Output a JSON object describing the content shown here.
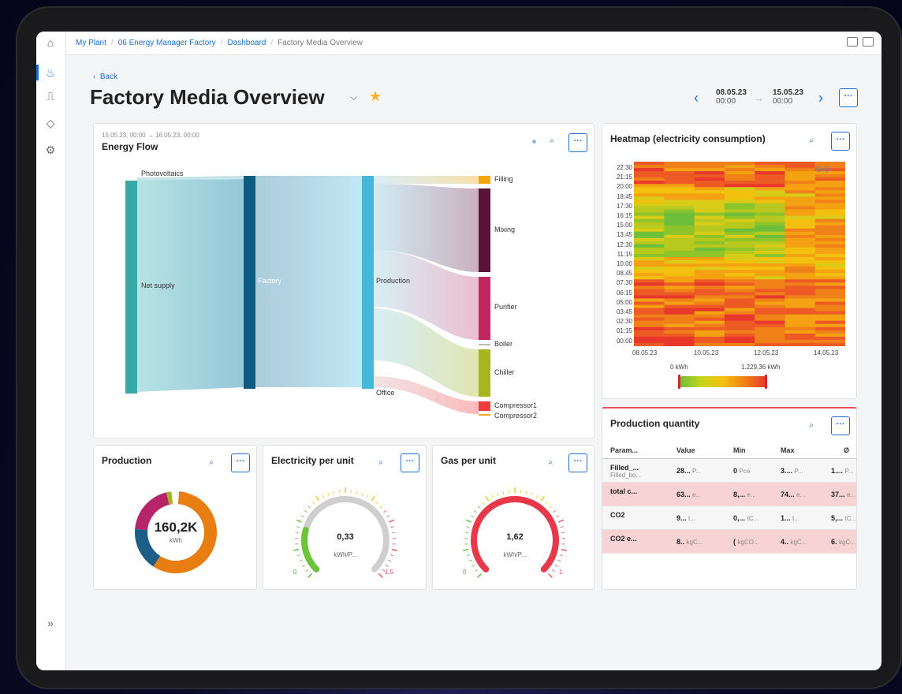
{
  "breadcrumb": {
    "items": [
      "My Plant",
      "06 Energy Manager Factory",
      "Dashboard",
      "Factory Media Overview"
    ]
  },
  "page": {
    "back_label": "Back",
    "title": "Factory Media Overview"
  },
  "date_range": {
    "from_date": "08.05.23",
    "from_time": "00:00",
    "to_date": "15.05.23",
    "to_time": "00:00"
  },
  "energy_flow": {
    "title": "Energy Flow",
    "subtitle": "15.05.23, 00:00 → 16.05.23, 00:00",
    "nodes": {
      "photovoltaics": "Photovoltaics",
      "net_supply": "Net supply",
      "factory": "Factory",
      "production": "Production",
      "office": "Office",
      "filling": "Filling",
      "mixing": "Mixing",
      "purifier": "Purifier",
      "boiler": "Boiler",
      "chiller": "Chiller",
      "compressor1": "Compressor1",
      "compressor2": "Compressor2"
    },
    "colors": {
      "net_supply": "#3aa8a8",
      "factory": "#0b5c80",
      "production": "#44b8d8",
      "filling": "#f2a50c",
      "mixing": "#5a1238",
      "purifier": "#c02660",
      "chiller": "#a8b41c",
      "compressor1": "#f03c3c"
    }
  },
  "heatmap": {
    "title": "Heatmap (electricity consumption)",
    "y_labels": [
      "22:30",
      "21:15",
      "20:00",
      "18:45",
      "17:30",
      "16:15",
      "15:00",
      "13:45",
      "12:30",
      "11:15",
      "10:00",
      "08:45",
      "07:30",
      "06:15",
      "05:00",
      "03:45",
      "02:30",
      "01:15",
      "00:00"
    ],
    "x_labels": [
      "08.05.23",
      "10.05.23",
      "12.05.23",
      "14.05.23"
    ],
    "legend_min": "0 kWh",
    "legend_max": "1.229,36 kWh"
  },
  "production_qty": {
    "title": "Production quantity",
    "columns": [
      "Param...",
      "Value",
      "Min",
      "Max",
      "Ø"
    ],
    "rows": [
      {
        "param": "Filled_...",
        "param2": "Filled_bo...",
        "value": "28...",
        "value_u": "P...",
        "min": "0",
        "min_u": "Pce",
        "max": "3....",
        "max_u": "P...",
        "avg": "1....",
        "avg_u": "P...",
        "style": "grey"
      },
      {
        "param": "total c...",
        "param2": "",
        "value": "63...",
        "value_u": "e...",
        "min": "8,...",
        "min_u": "e...",
        "max": "74...",
        "max_u": "e...",
        "avg": "37...",
        "avg_u": "e...",
        "style": "pink"
      },
      {
        "param": "CO2",
        "param2": "",
        "value": "9...",
        "value_u": "t...",
        "min": "0,...",
        "min_u": "tC...",
        "max": "1...",
        "max_u": "t...",
        "avg": "5,...",
        "avg_u": "tC...",
        "style": "grey"
      },
      {
        "param": "CO2 e...",
        "param2": "",
        "value": "8..",
        "value_u": "kgC...",
        "min": "(",
        "min_u": "kgCO...",
        "max": "4..",
        "max_u": "kgC...",
        "avg": "6.",
        "avg_u": "kgC...",
        "style": "pink"
      }
    ]
  },
  "production": {
    "title": "Production",
    "value": "160,2K",
    "unit": "kWh",
    "segments": [
      {
        "color": "#e87d12",
        "share": 0.58
      },
      {
        "color": "#1c5f86",
        "share": 0.17
      },
      {
        "color": "#b8246a",
        "share": 0.2
      },
      {
        "color": "#a8b41c",
        "share": 0.02
      }
    ]
  },
  "electricity": {
    "title": "Electricity per unit",
    "value": "0,33",
    "unit": "kWh/P...",
    "min": "0",
    "max": "1,5",
    "fraction": 0.22
  },
  "gas": {
    "title": "Gas per unit",
    "value": "1,62",
    "unit": "kWh/P...",
    "min": "0",
    "max": "1",
    "fraction": 1.0
  }
}
